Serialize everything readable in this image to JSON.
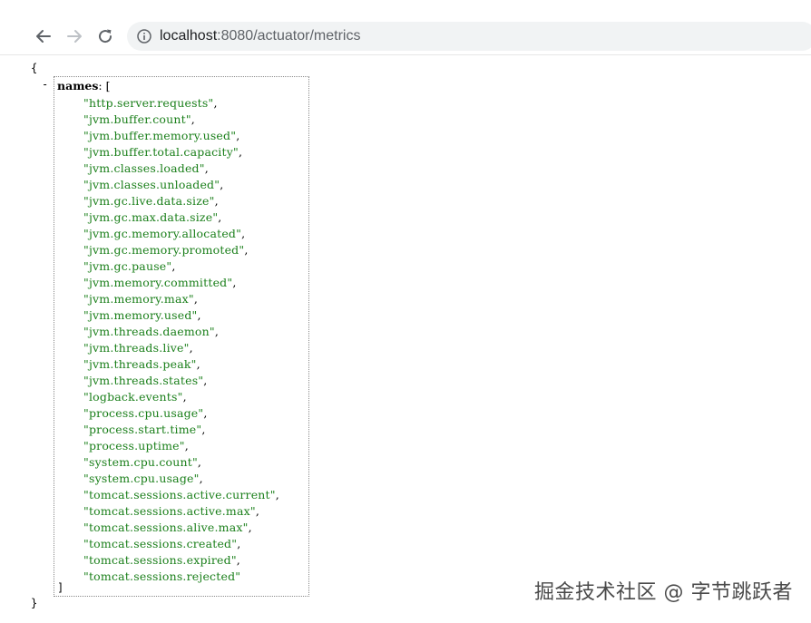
{
  "browser": {
    "url_host": "localhost",
    "url_path": ":8080/actuator/metrics",
    "icons": {
      "back": "arrow-left-icon",
      "forward": "arrow-right-icon",
      "reload": "reload-icon",
      "info": "info-circle-icon"
    }
  },
  "json": {
    "open_brace": "{",
    "close_brace": "}",
    "collapse_toggle": "-",
    "key": "names",
    "key_suffix": ": [",
    "close_bracket": "]",
    "names": [
      "\"http.server.requests\"",
      "\"jvm.buffer.count\"",
      "\"jvm.buffer.memory.used\"",
      "\"jvm.buffer.total.capacity\"",
      "\"jvm.classes.loaded\"",
      "\"jvm.classes.unloaded\"",
      "\"jvm.gc.live.data.size\"",
      "\"jvm.gc.max.data.size\"",
      "\"jvm.gc.memory.allocated\"",
      "\"jvm.gc.memory.promoted\"",
      "\"jvm.gc.pause\"",
      "\"jvm.memory.committed\"",
      "\"jvm.memory.max\"",
      "\"jvm.memory.used\"",
      "\"jvm.threads.daemon\"",
      "\"jvm.threads.live\"",
      "\"jvm.threads.peak\"",
      "\"jvm.threads.states\"",
      "\"logback.events\"",
      "\"process.cpu.usage\"",
      "\"process.start.time\"",
      "\"process.uptime\"",
      "\"system.cpu.count\"",
      "\"system.cpu.usage\"",
      "\"tomcat.sessions.active.current\"",
      "\"tomcat.sessions.active.max\"",
      "\"tomcat.sessions.alive.max\"",
      "\"tomcat.sessions.created\"",
      "\"tomcat.sessions.expired\"",
      "\"tomcat.sessions.rejected\""
    ]
  },
  "watermark": "掘金技术社区 @ 字节跳跃者",
  "colors": {
    "string_value": "#1a7f1a",
    "omnibox_bg": "#f1f3f4"
  }
}
